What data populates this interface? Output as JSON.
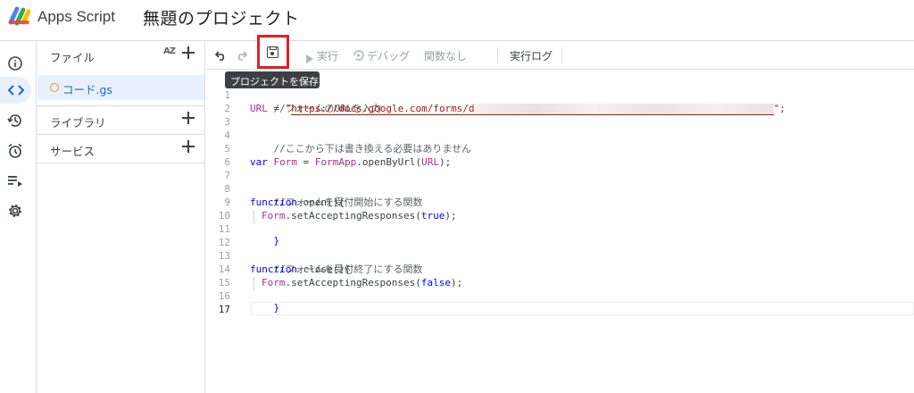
{
  "header": {
    "app_name": "Apps Script",
    "project_title": "無題のプロジェクト"
  },
  "files_panel": {
    "title": "ファイル",
    "sort_label": "AZ",
    "files": [
      {
        "name": "コード.gs"
      }
    ],
    "libraries_label": "ライブラリ",
    "services_label": "サービス"
  },
  "toolbar": {
    "run_label": "実行",
    "debug_label": "デバッグ",
    "function_label": "関数なし",
    "log_label": "実行ログ"
  },
  "tooltip": "プロジェクトを保存",
  "editor": {
    "line_numbers": [
      "1",
      "2",
      "3",
      "4",
      "5",
      "6",
      "7",
      "8",
      "9",
      "10",
      "11",
      "12",
      "13",
      "14",
      "15",
      "16",
      "17"
    ],
    "current_line": 17,
    "lines": {
      "l1": "//フォームのURLを入力",
      "l2_kw": "URL",
      "l2_eq": " = ",
      "l2_q1": "\"",
      "l2_url": "https://docs.google.com/forms/d",
      "l2_q2": "\";",
      "l4": "//ここから下は書き換える必要はありません",
      "l6_var": "var",
      "l6_name": " Form ",
      "l6_eq": "= ",
      "l6_obj": "FormApp",
      "l6_method": ".openByUrl(",
      "l6_arg": "URL",
      "l6_end": ");",
      "l8": "//フォームを受付開始にする関数",
      "l9_fn": "function",
      "l9_rest": " open(){",
      "l10_obj": "Form",
      "l10_method": ".setAcceptingResponses(",
      "l10_val": "true",
      "l10_end": ");",
      "l11": "}",
      "l13": "//フォームを受付終了にする関数",
      "l14_fn": "function",
      "l14_rest": " close(){",
      "l15_obj": "Form",
      "l15_method": ".setAcceptingResponses(",
      "l15_val": "false",
      "l15_end": ");",
      "l16": "}"
    }
  },
  "colors": {
    "accent": "#1967d2",
    "highlight_border": "#e2202a",
    "selected_bg": "#e8f0fe"
  }
}
